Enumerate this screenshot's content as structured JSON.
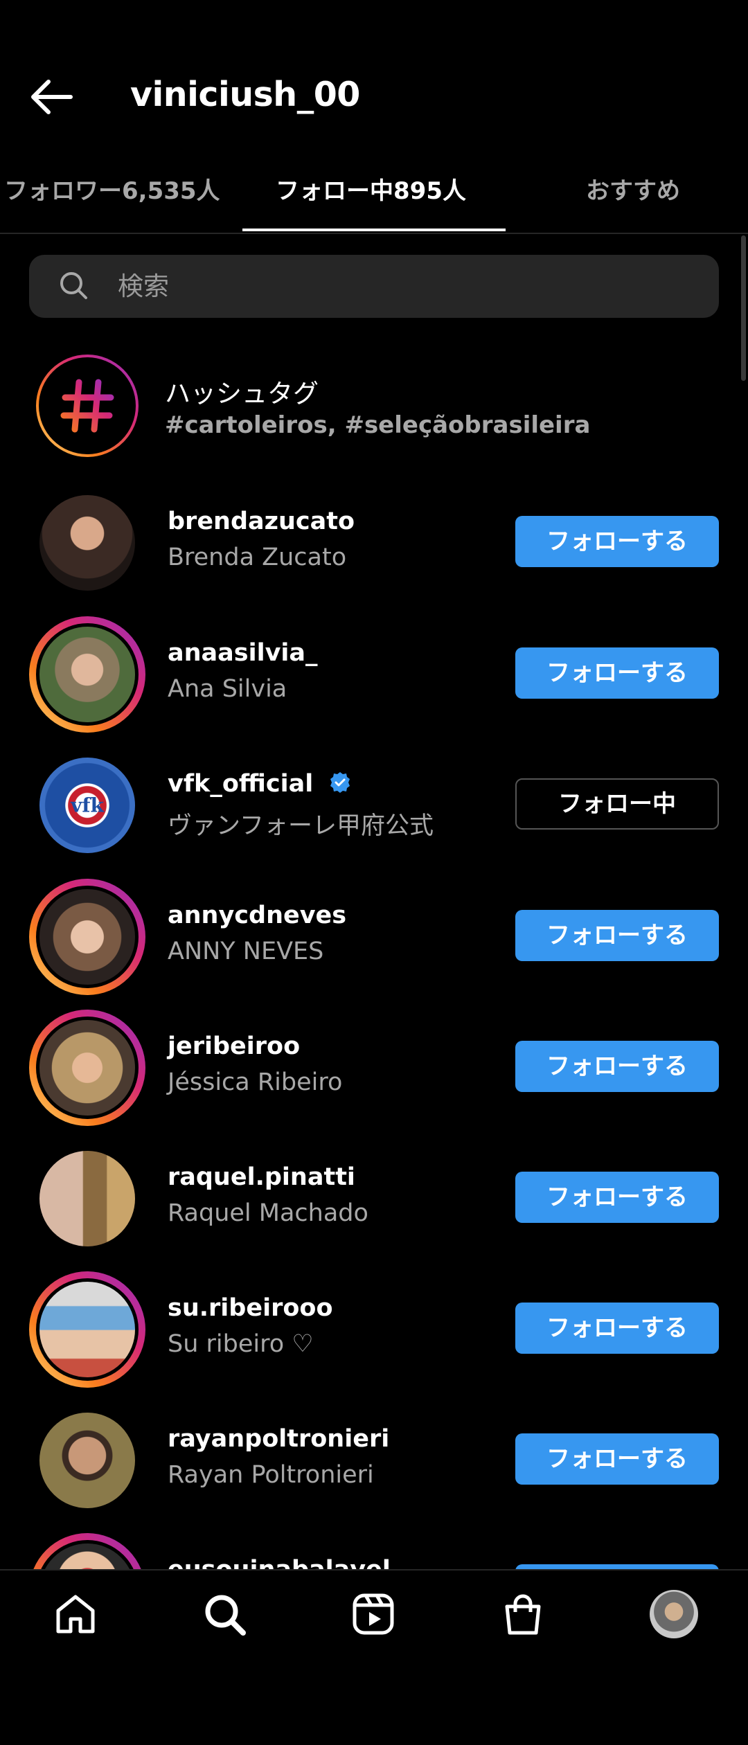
{
  "header": {
    "title": "viniciush_00",
    "back_icon": "arrow-left-icon"
  },
  "tabs": [
    {
      "label": "フォロワー6,535人",
      "active": false
    },
    {
      "label": "フォロー中895人",
      "active": true
    },
    {
      "label": "おすすめ",
      "active": false
    }
  ],
  "search": {
    "placeholder": "検索",
    "value": ""
  },
  "hashtags": {
    "title": "ハッシュタグ",
    "subtitle": "#cartoleiros, #seleçãobrasileira"
  },
  "accounts": [
    {
      "username": "brendazucato",
      "name": "Brenda Zucato",
      "button": "フォローする",
      "story_ring": false
    },
    {
      "username": "anaasilvia_",
      "name": "Ana Silvia",
      "button": "フォローする",
      "story_ring": true
    },
    {
      "username": "vfk_official",
      "name": "ヴァンフォーレ甲府公式",
      "button": "フォロー中",
      "story_ring": false,
      "verified": true
    },
    {
      "username": "annycdneves",
      "name": "ANNY NEVES",
      "button": "フォローする",
      "story_ring": true
    },
    {
      "username": "jeribeiroo",
      "name": "Jéssica Ribeiro",
      "button": "フォローする",
      "story_ring": true
    },
    {
      "username": "raquel.pinatti",
      "name": "Raquel Machado",
      "button": "フォローする",
      "story_ring": false
    },
    {
      "username": "su.ribeirooo",
      "name": "Su ribeiro ♡",
      "button": "フォローする",
      "story_ring": true
    },
    {
      "username": "rayanpoltronieri",
      "name": "Rayan Poltronieri",
      "button": "フォローする",
      "story_ring": false
    },
    {
      "username": "eusouinabalavel",
      "name": "",
      "button": "",
      "story_ring": true
    }
  ],
  "bottom_nav": [
    "home-icon",
    "search-icon",
    "reels-icon",
    "shop-icon",
    "profile-avatar"
  ],
  "colors": {
    "accent": "#3797f0",
    "background": "#000000",
    "secondary_text": "#a8a8a8"
  }
}
